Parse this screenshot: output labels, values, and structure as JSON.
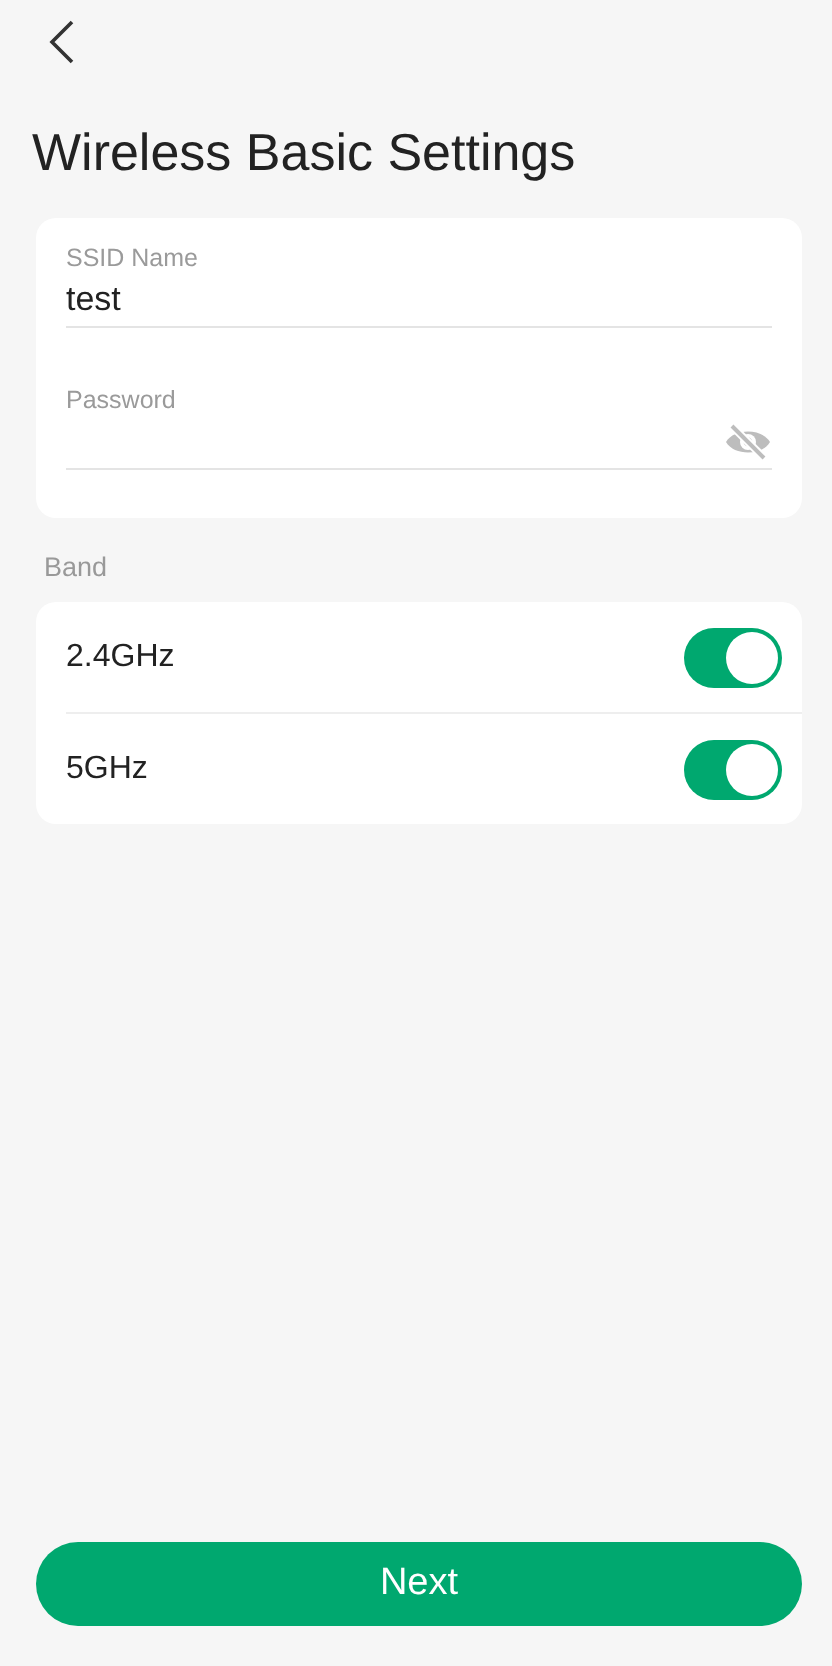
{
  "title": "Wireless Basic Settings",
  "fields": [
    {
      "label": "SSID Name",
      "value": "test",
      "kind": "text"
    },
    {
      "label": "Password",
      "kind": "password",
      "visible": false
    }
  ],
  "band": {
    "label": "Band",
    "items": [
      {
        "label": "2.4GHz",
        "on": true
      },
      {
        "label": "5GHz",
        "on": true
      }
    ]
  },
  "button": "Next"
}
